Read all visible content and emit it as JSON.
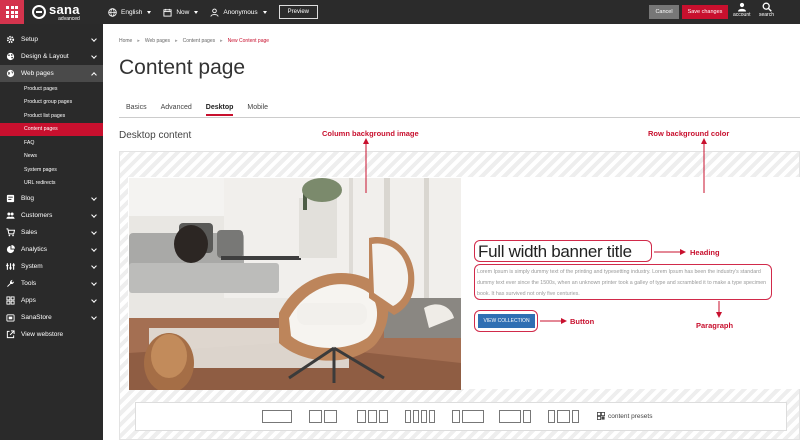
{
  "topbar": {
    "brand": "sana",
    "brand_sub": "advanced",
    "language": "English",
    "time": "Now",
    "user": "Anonymous",
    "preview": "Preview",
    "cancel": "Cancel",
    "save": "Save changes",
    "account": "account",
    "search": "search"
  },
  "sidebar": {
    "items": [
      {
        "label": "Setup",
        "icon": "gear-icon"
      },
      {
        "label": "Design & Layout",
        "icon": "palette-icon"
      },
      {
        "label": "Web pages",
        "icon": "globe-icon"
      },
      {
        "label": "Blog",
        "icon": "blog-icon"
      },
      {
        "label": "Customers",
        "icon": "users-icon"
      },
      {
        "label": "Sales",
        "icon": "cart-icon"
      },
      {
        "label": "Analytics",
        "icon": "analytics-icon"
      },
      {
        "label": "System",
        "icon": "system-icon"
      },
      {
        "label": "Tools",
        "icon": "wrench-icon"
      },
      {
        "label": "Apps",
        "icon": "apps-icon"
      },
      {
        "label": "SanaStore",
        "icon": "store-icon"
      },
      {
        "label": "View webstore",
        "icon": "external-link-icon"
      }
    ],
    "subitems": [
      "Product pages",
      "Product group pages",
      "Product list pages",
      "Content pages",
      "FAQ",
      "News",
      "System pages",
      "URL redirects"
    ]
  },
  "breadcrumb": [
    "Home",
    "Web pages",
    "Content pages",
    "New Content page"
  ],
  "page_title": "Content page",
  "tabs": [
    "Basics",
    "Advanced",
    "Desktop",
    "Mobile"
  ],
  "section_title": "Desktop content",
  "banner": {
    "heading": "Full width banner title",
    "paragraph": "Lorem Ipsum is simply dummy text of the printing and typesetting industry. Lorem Ipsum has been the industry's standard dummy text ever since the 1500s, when an unknown printer took a galley of type and scrambled it to make a type specimen book. It has survived not only five centuries.",
    "button": "VIEW COLLECTION"
  },
  "annotations": {
    "column_bg": "Column background image",
    "row_bg": "Row background color",
    "heading": "Heading",
    "button": "Button",
    "paragraph": "Paragraph"
  },
  "presets_label": "content presets",
  "colors": {
    "accent": "#c8102e",
    "sidebar": "#2a2a2a",
    "button_blue": "#2f6fb3"
  }
}
